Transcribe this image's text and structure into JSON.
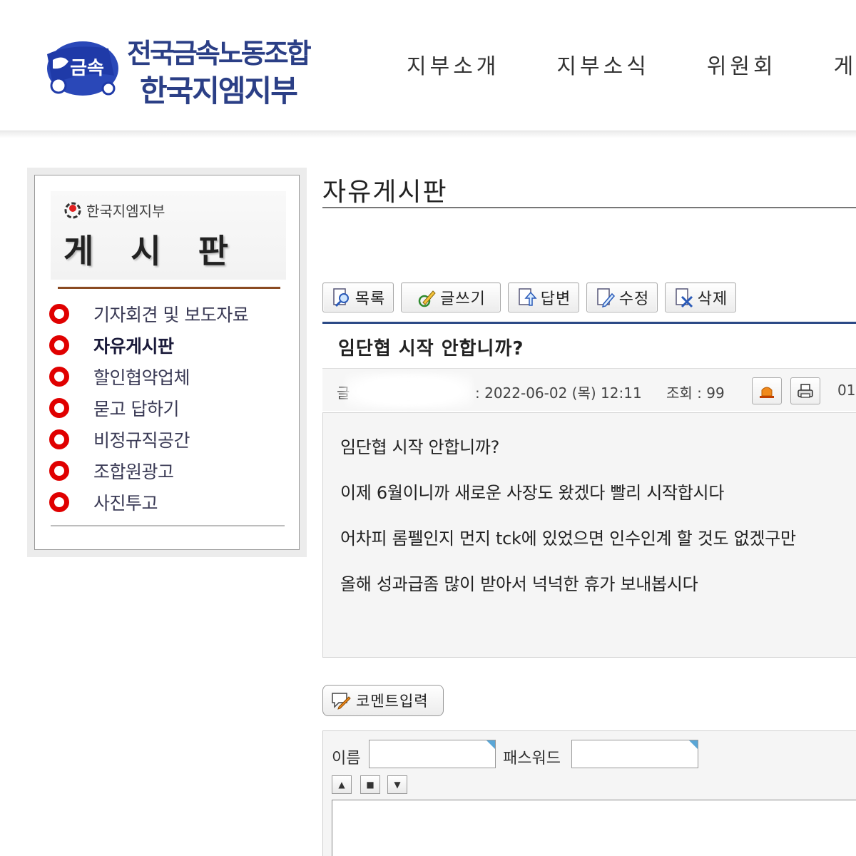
{
  "header": {
    "logo_line1": "전국금속노동조합",
    "logo_line2": "한국지엠지부",
    "logo_badge": "금속",
    "nav": [
      "지부소개",
      "지부소식",
      "위원회",
      "게시"
    ]
  },
  "sidebar": {
    "org": "한국지엠지부",
    "title": "게 시 판",
    "items": [
      {
        "label": "기자회견 및 보도자료"
      },
      {
        "label": "자유게시판"
      },
      {
        "label": "할인협약업체"
      },
      {
        "label": "묻고 답하기"
      },
      {
        "label": "비정규직공간"
      },
      {
        "label": "조합원광고"
      },
      {
        "label": "사진투고"
      }
    ],
    "active_index": 1
  },
  "board": {
    "title": "자유게시판"
  },
  "toolbar": {
    "list": "목록",
    "write": "글쓰기",
    "reply": "답변",
    "edit": "수정",
    "delete": "삭제"
  },
  "post": {
    "title": "임단협 시작 안합니까?",
    "author_label": "글",
    "date": ": 2022-06-02 (목) 12:11",
    "views": "조회 : 99",
    "number": "01",
    "body": [
      "임단협 시작 안합니까?",
      "이제 6월이니까 새로운 사장도 왔겠다 빨리 시작합시다",
      "어차피 롬펠인지 먼지 tck에 있었으면 인수인계 할 것도 없겠구만",
      "올해 성과급좀 많이 받아서 넉넉한 휴가 보내봅시다"
    ]
  },
  "comment": {
    "button": "코멘트입력",
    "name_label": "이름",
    "password_label": "패스워드",
    "name_value": "",
    "password_value": ""
  },
  "colors": {
    "brand": "#2b3f86",
    "bullet": "#e00000",
    "rule": "#8a4a22",
    "post_rule": "#2c4a86"
  }
}
